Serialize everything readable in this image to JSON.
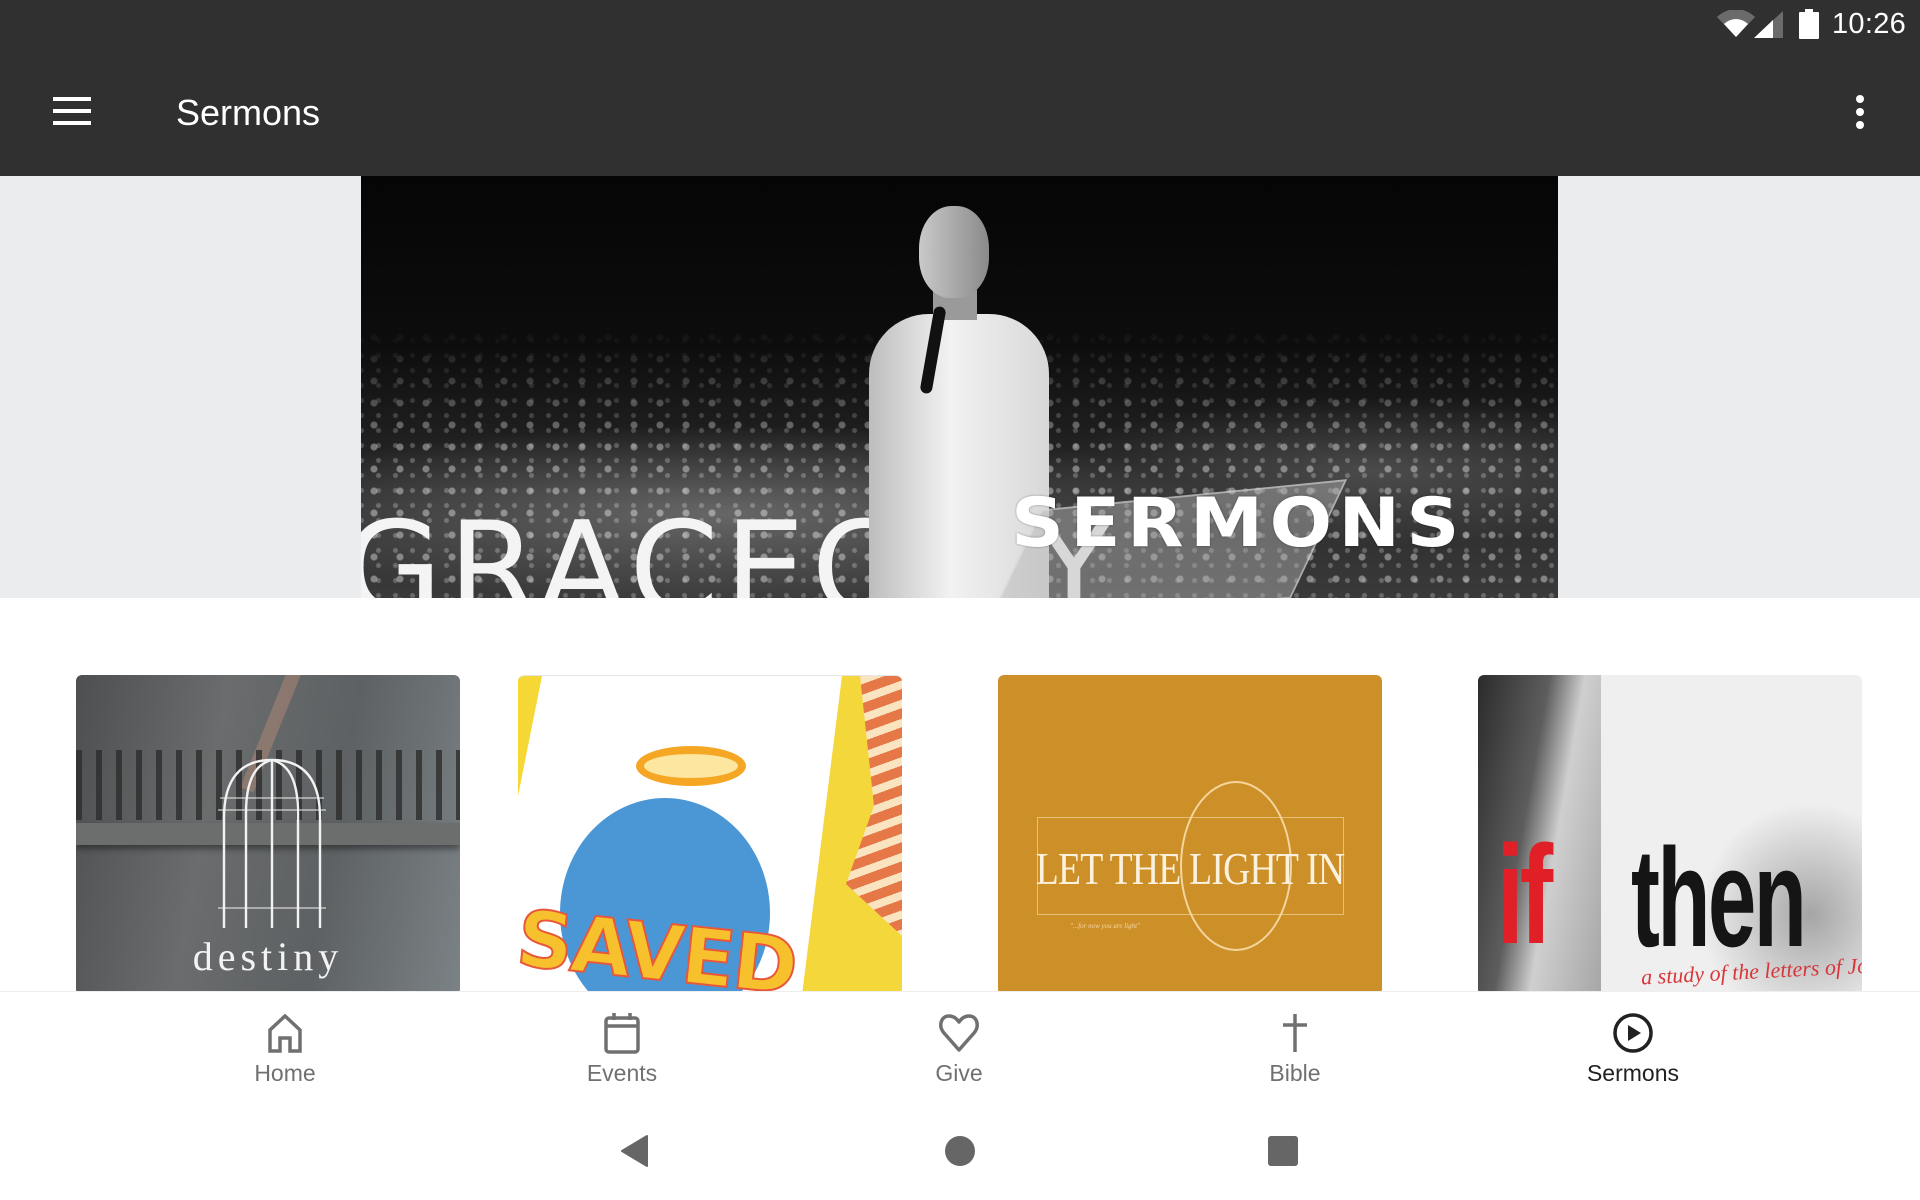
{
  "status_bar": {
    "time": "10:26",
    "icons": [
      "wifi-icon",
      "cellular-signal-icon",
      "battery-icon"
    ]
  },
  "app_bar": {
    "title": "Sermons",
    "menu_icon": "hamburger-menu-icon",
    "overflow_icon": "more-vert-icon"
  },
  "banner": {
    "overlay_text": "SERMONS",
    "photo_signage_text": "GRACECITY"
  },
  "sermon_series": [
    {
      "title": "destiny"
    },
    {
      "title": "SAVED"
    },
    {
      "title": "LET THE LIGHT IN",
      "subtitle": "\"...for now you are light\""
    },
    {
      "title_part1": "if",
      "title_part2": "then",
      "subtitle": "a study of the letters of John"
    }
  ],
  "colors": {
    "app_bar": "#303030",
    "active_nav": "#212121",
    "inactive_nav": "#707070",
    "let_the_light_in_bg": "#cd9029",
    "if_red": "#e11f26"
  },
  "bottom_nav": {
    "items": [
      {
        "label": "Home",
        "icon": "home-icon",
        "active": false
      },
      {
        "label": "Events",
        "icon": "calendar-icon",
        "active": false
      },
      {
        "label": "Give",
        "icon": "heart-icon",
        "active": false
      },
      {
        "label": "Bible",
        "icon": "cross-icon",
        "active": false
      },
      {
        "label": "Sermons",
        "icon": "play-circle-icon",
        "active": true
      }
    ]
  },
  "system_nav": {
    "buttons": [
      "back-icon",
      "home-circle-icon",
      "recents-icon"
    ]
  }
}
